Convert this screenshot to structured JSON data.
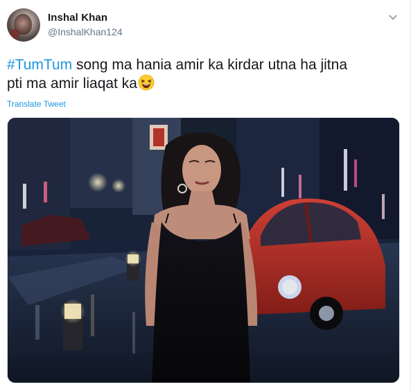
{
  "tweet": {
    "author_name": "Inshal Khan",
    "author_handle": "@InshalKhan124",
    "hashtag": "#TumTum",
    "text_part1": "  song ma hania amir ka kirdar utna ha jitna",
    "text_part2": "pti ma amir liaqat ka",
    "emoji": "laughing-squinting-face",
    "translate_label": "Translate Tweet"
  },
  "media": {
    "type": "video-still",
    "description_icons": [
      "woman-in-black-dress",
      "red-vintage-car",
      "neon-street"
    ]
  },
  "colors": {
    "link": "#1b95e0",
    "text": "#14171a",
    "secondary_text": "#657786",
    "border": "#e1e8ed"
  }
}
